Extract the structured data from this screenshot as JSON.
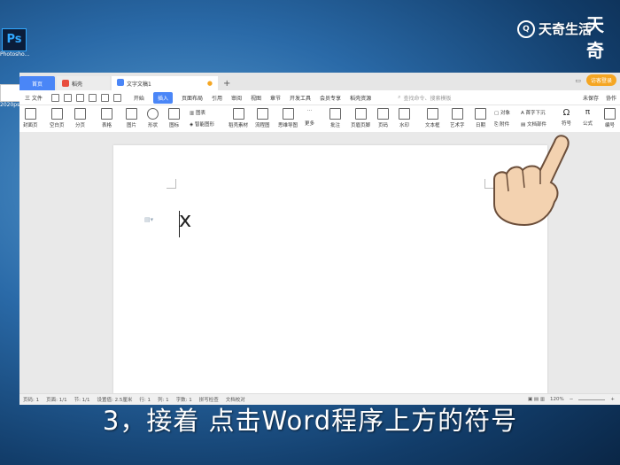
{
  "desktop": {
    "ps_icon": "Ps",
    "ps_label": "Photosho...",
    "doc_label": "2020ps..."
  },
  "watermark": {
    "text": "天奇生活",
    "corner_text": "天奇"
  },
  "tabs": [
    {
      "label": "首页"
    },
    {
      "label": "稻壳"
    },
    {
      "label": "文字文稿1"
    }
  ],
  "tab_plus": "+",
  "login_label": "访客登录",
  "menu": {
    "file": "三 文件",
    "items": [
      "开始",
      "插入",
      "页面布局",
      "引用",
      "审阅",
      "视图",
      "章节",
      "开发工具",
      "会员专享",
      "稻壳资源"
    ],
    "active": "插入",
    "search_placeholder": "查找命令、搜索模板",
    "right": [
      "未保存",
      "协作"
    ]
  },
  "ribbon": [
    "封面页",
    "空白页",
    "分页",
    "表格",
    "图片",
    "形状",
    "图标",
    "图表",
    "智能图形",
    "稻壳素材",
    "流程图",
    "思维导图",
    "更多",
    "批注",
    "页眉页脚",
    "页码",
    "水印",
    "文本框",
    "艺术字",
    "日期",
    "对象",
    "首字下沉",
    "附件",
    "文档部件",
    "符号",
    "公式",
    "编号"
  ],
  "document": {
    "text": "x"
  },
  "status": {
    "left": [
      "页码: 1",
      "页面: 1/1",
      "节: 1/1",
      "设置值: 2.5厘米",
      "行: 1",
      "列: 1",
      "字数: 1",
      "拼写检查",
      "文档校对"
    ],
    "zoom": "120%"
  },
  "subtitle": "3，接着 点击Word程序上方的符号"
}
